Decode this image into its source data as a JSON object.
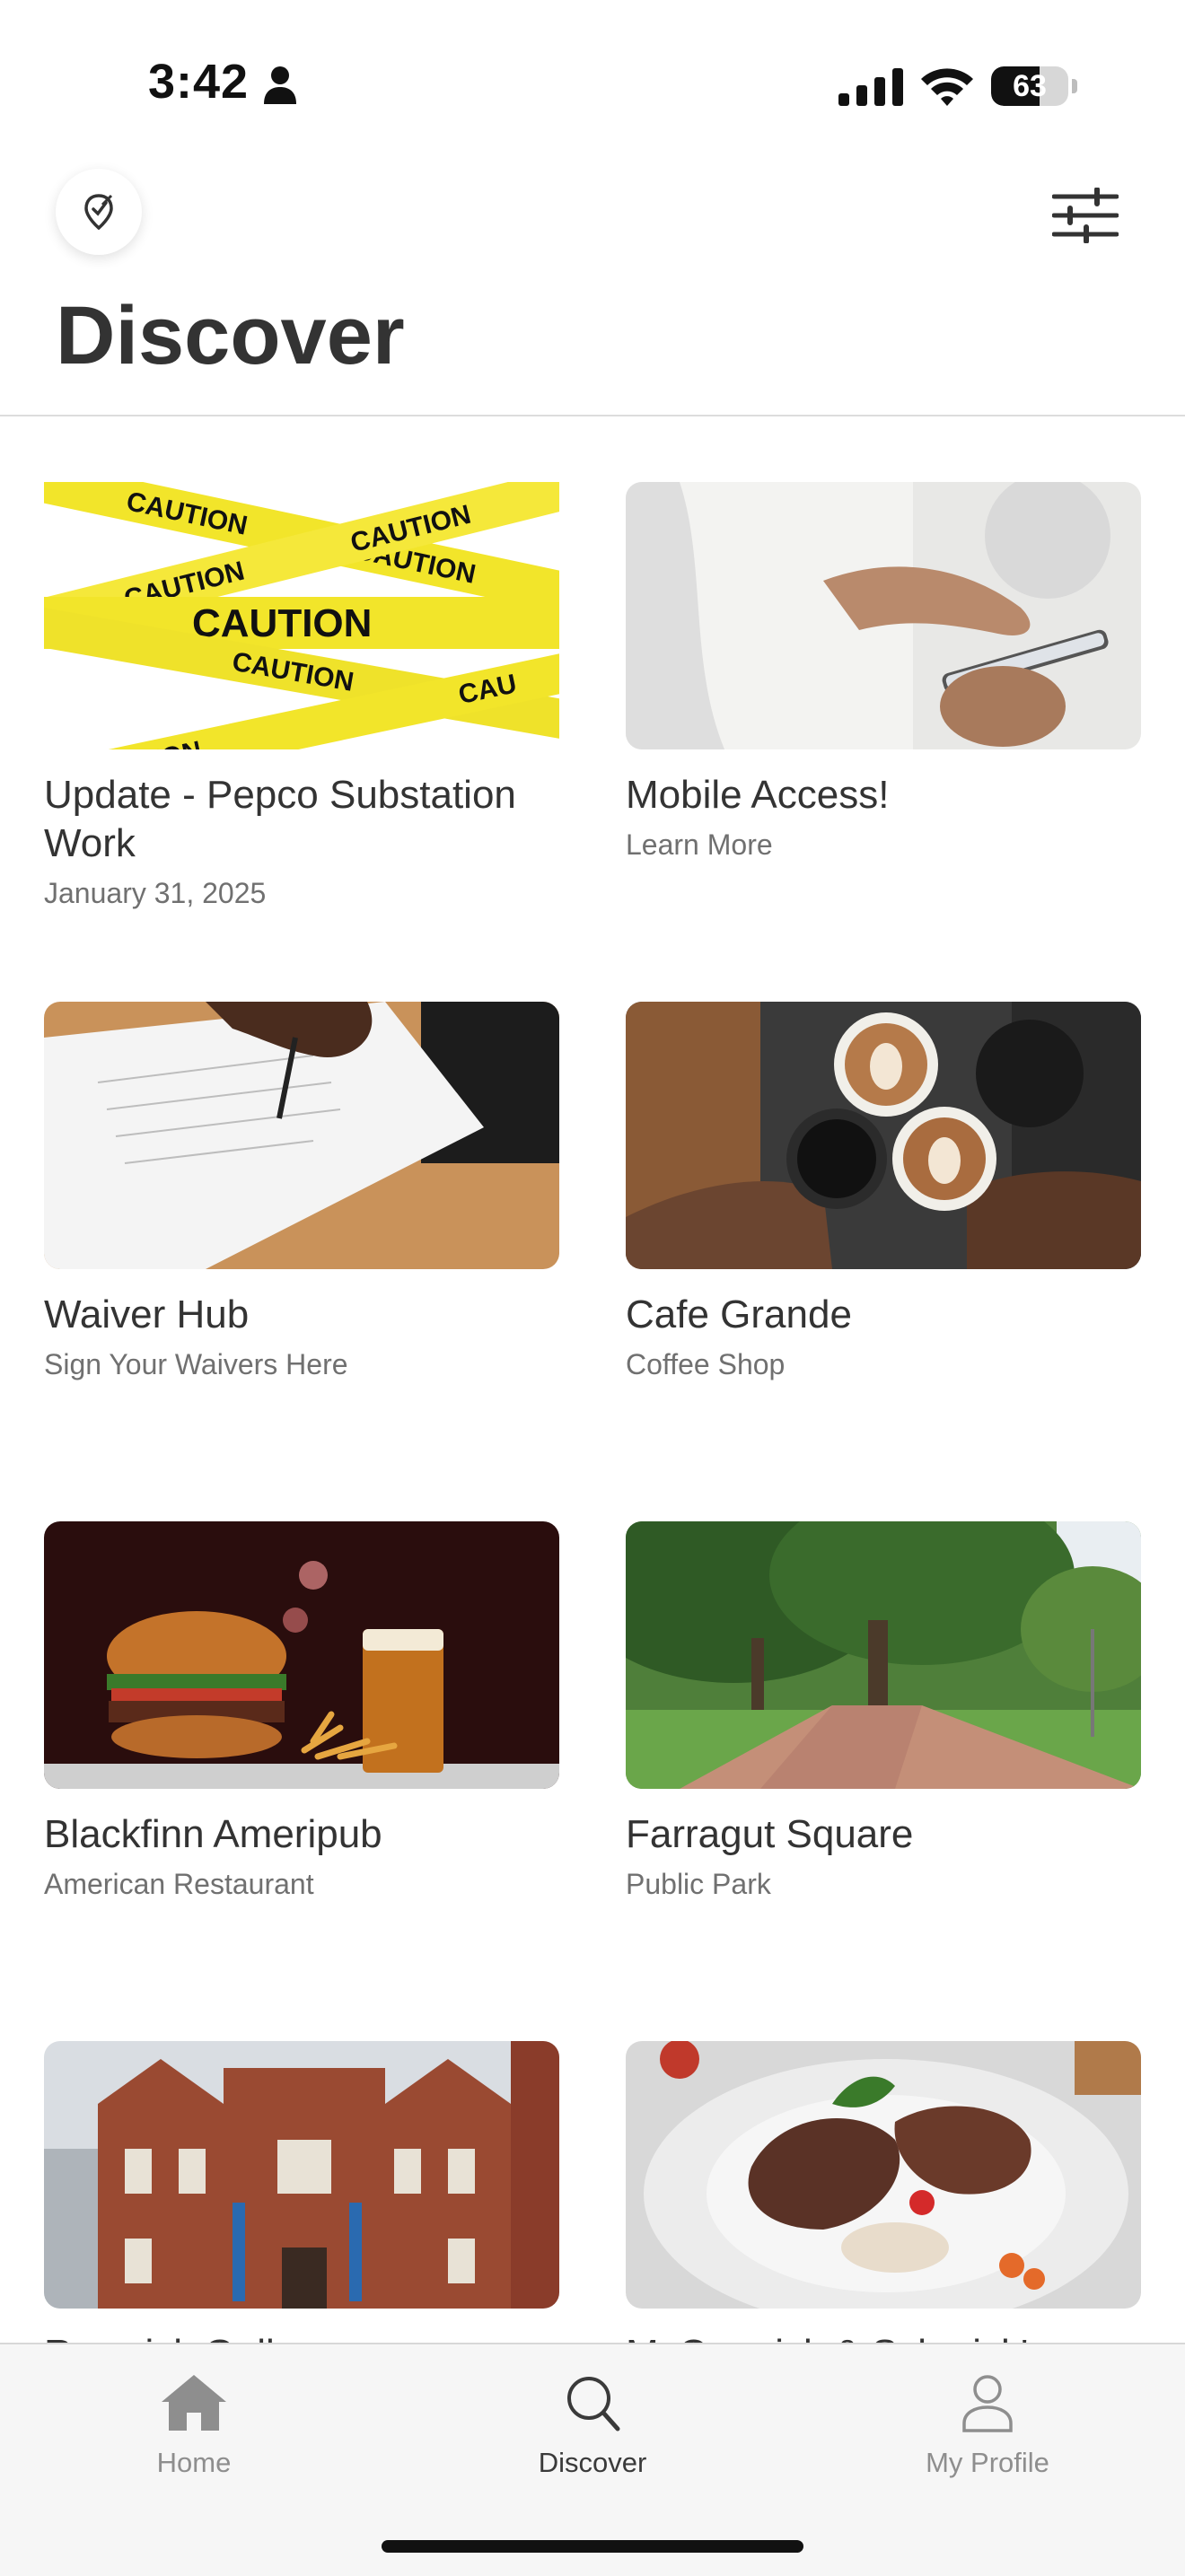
{
  "status_bar": {
    "time": "3:42",
    "battery": "63",
    "battery_level": 0.63
  },
  "header": {
    "title": "Discover"
  },
  "cards": [
    {
      "title": "Update - Pepco Substation Work",
      "subtitle": "January 31, 2025",
      "image": "caution-tape"
    },
    {
      "title": "Mobile Access!",
      "subtitle": "Learn More",
      "image": "phone-hands"
    },
    {
      "title": "Waiver Hub",
      "subtitle": "Sign Your Waivers Here",
      "image": "signing-document"
    },
    {
      "title": "Cafe Grande",
      "subtitle": "Coffee Shop",
      "image": "coffee-cups"
    },
    {
      "title": "Blackfinn Ameripub",
      "subtitle": "American Restaurant",
      "image": "burger-beer"
    },
    {
      "title": "Farragut Square",
      "subtitle": "Public Park",
      "image": "park-trees"
    },
    {
      "title": "Renwick Gallery",
      "subtitle": "",
      "image": "red-brick-building"
    },
    {
      "title": "McCormick & Schmick's",
      "subtitle": "",
      "image": "steak-plate"
    }
  ],
  "tabs": [
    {
      "label": "Home",
      "icon": "home-icon"
    },
    {
      "label": "Discover",
      "icon": "search-icon"
    },
    {
      "label": "My Profile",
      "icon": "person-icon"
    }
  ],
  "colors": {
    "title": "#333333",
    "subtitle": "#707070",
    "tab_inactive": "#8e8e8e",
    "tab_active": "#3a3a3a",
    "caution_yellow": "#f2e52a"
  }
}
